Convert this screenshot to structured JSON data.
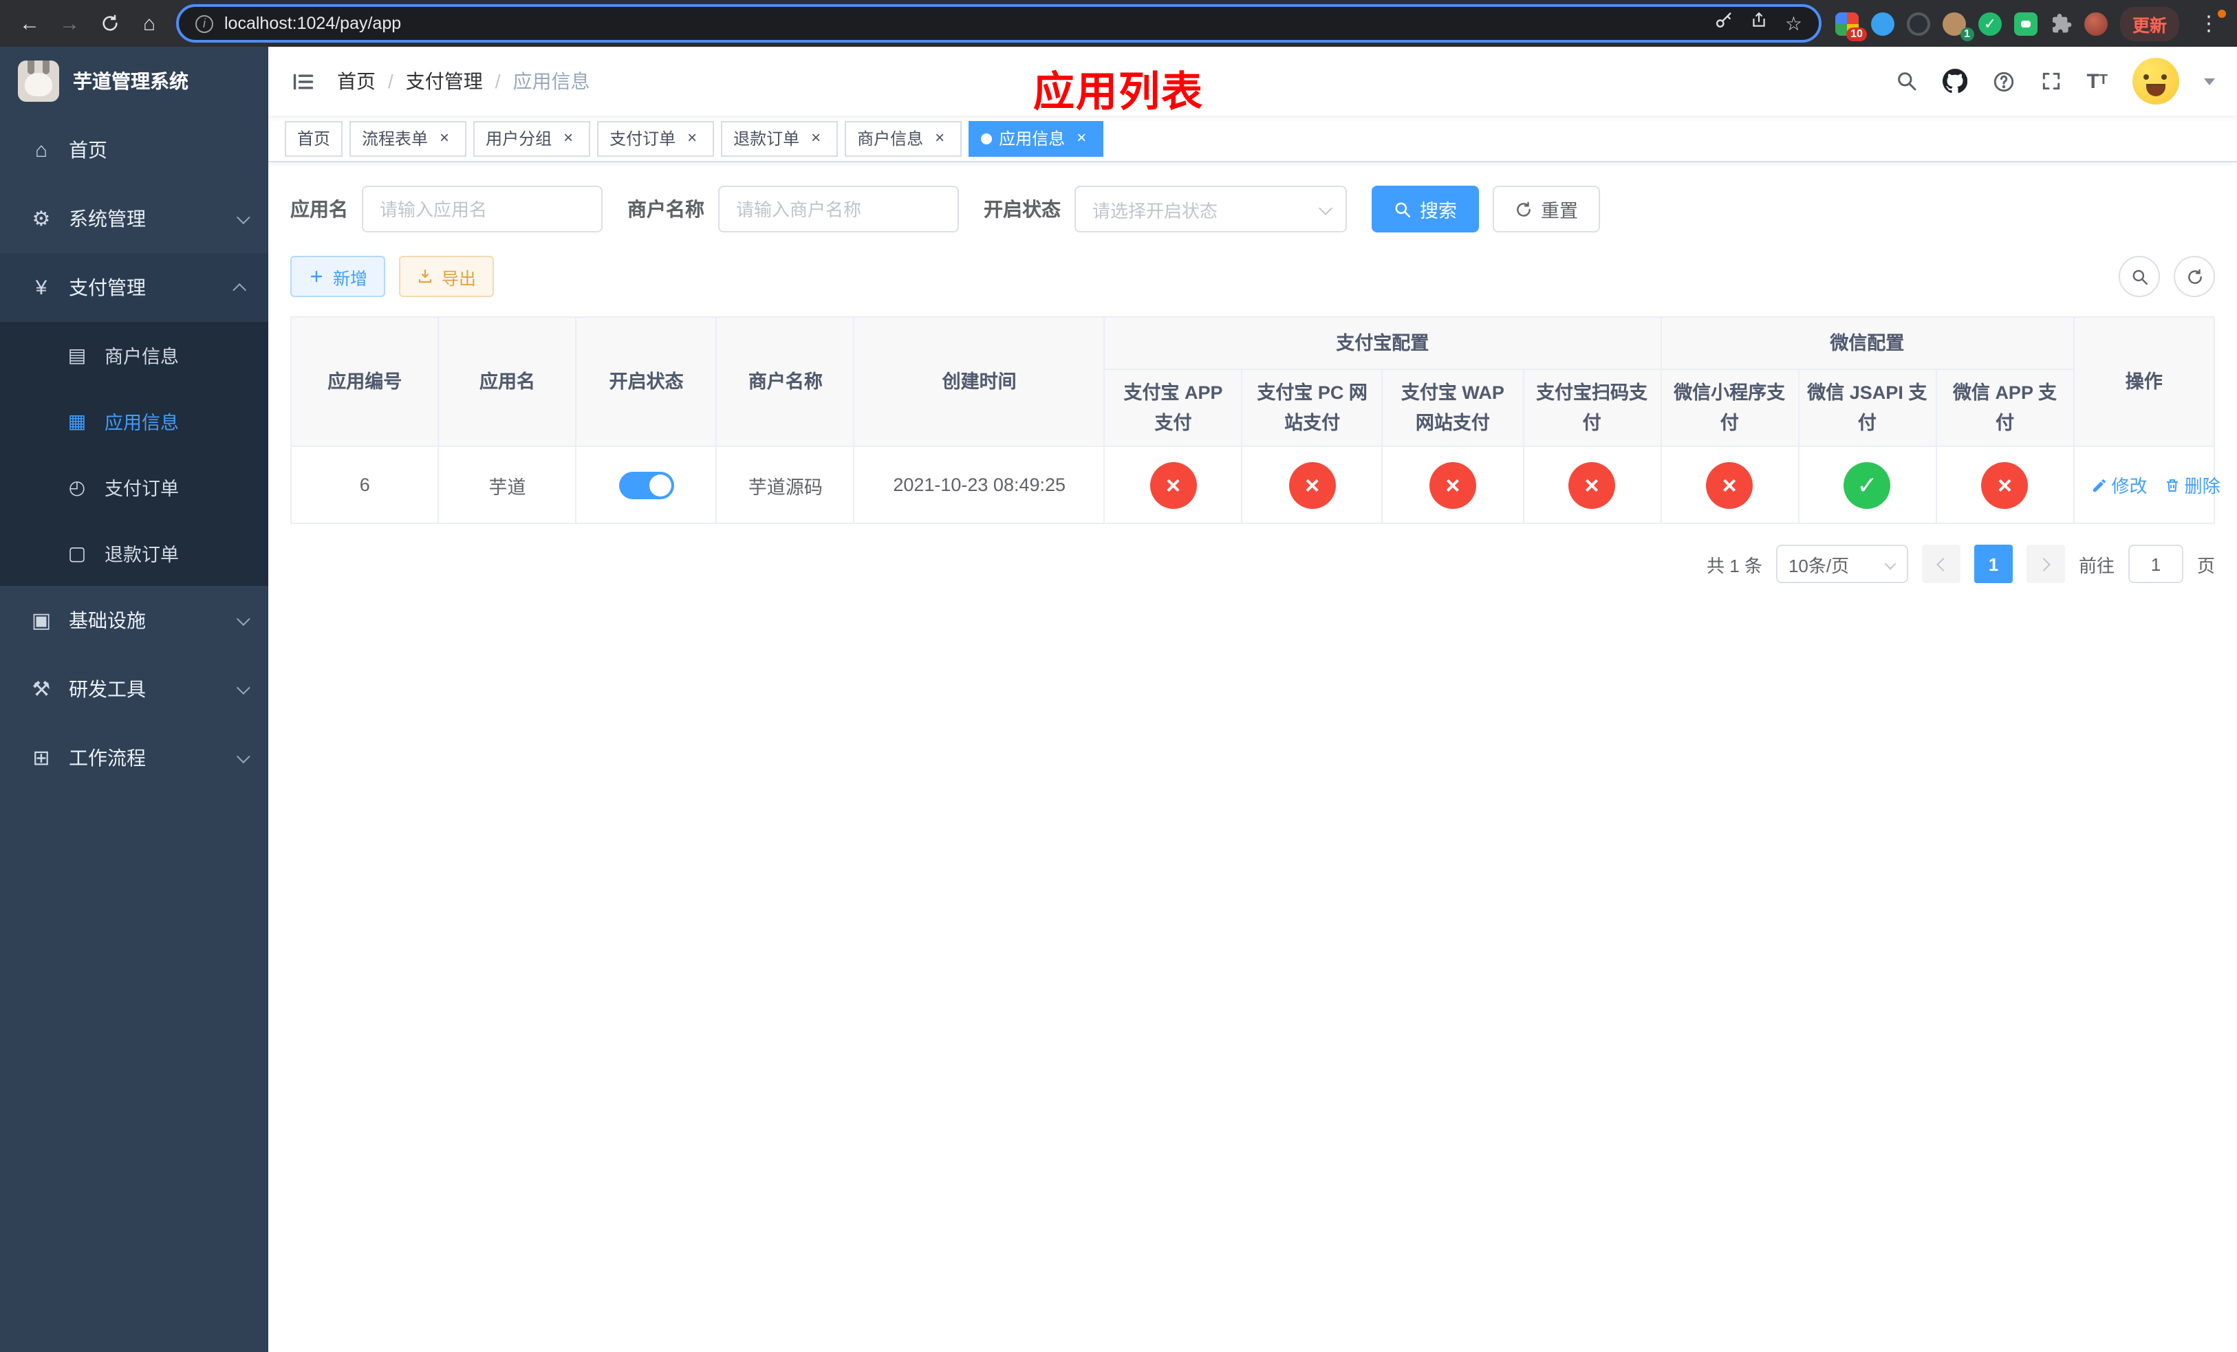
{
  "colors": {
    "accent": "#409eff",
    "danger": "#f5483b",
    "success": "#2bc458",
    "warning": "#e6a23c",
    "title_red": "#ff0000",
    "sidebar_bg": "#304156",
    "submenu_bg": "#1f2d3d"
  },
  "browser": {
    "url": "localhost:1024/pay/app",
    "update_label": "更新",
    "ext_badge_ten": "10",
    "ext_badge_one": "1"
  },
  "sidebar": {
    "logo_title": "芋道管理系统",
    "items": [
      {
        "label": "首页"
      },
      {
        "label": "系统管理"
      },
      {
        "label": "支付管理",
        "children": [
          {
            "label": "商户信息"
          },
          {
            "label": "应用信息"
          },
          {
            "label": "支付订单"
          },
          {
            "label": "退款订单"
          }
        ]
      },
      {
        "label": "基础设施"
      },
      {
        "label": "研发工具"
      },
      {
        "label": "工作流程"
      }
    ],
    "icons": {
      "home": "⌂",
      "system": "⚙",
      "pay": "¥",
      "merchant": "▤",
      "app": "▦",
      "order": "◴",
      "refund": "▢",
      "infra": "▣",
      "devtool": "⚒",
      "workflow": "⊞"
    }
  },
  "navbar": {
    "breadcrumb": [
      "首页",
      "支付管理",
      "应用信息"
    ],
    "page_title": "应用列表"
  },
  "tabs": [
    {
      "label": "首页"
    },
    {
      "label": "流程表单"
    },
    {
      "label": "用户分组"
    },
    {
      "label": "支付订单"
    },
    {
      "label": "退款订单"
    },
    {
      "label": "商户信息"
    },
    {
      "label": "应用信息"
    }
  ],
  "filters": {
    "app_name_label": "应用名",
    "app_name_placeholder": "请输入应用名",
    "merchant_label": "商户名称",
    "merchant_placeholder": "请输入商户名称",
    "status_label": "开启状态",
    "status_placeholder": "请选择开启状态",
    "search_label": "搜索",
    "reset_label": "重置"
  },
  "toolbar": {
    "add_label": "新增",
    "export_label": "导出"
  },
  "table": {
    "groups": {
      "alipay": "支付宝配置",
      "wechat": "微信配置"
    },
    "columns": [
      "应用编号",
      "应用名",
      "开启状态",
      "商户名称",
      "创建时间",
      "支付宝 APP 支付",
      "支付宝 PC 网站支付",
      "支付宝 WAP 网站支付",
      "支付宝扫码支付",
      "微信小程序支付",
      "微信 JSAPI 支付",
      "微信 APP 支付",
      "操作"
    ],
    "rows": [
      {
        "id": "6",
        "name": "芋道",
        "enabled": true,
        "merchant": "芋道源码",
        "created": "2021-10-23 08:49:25",
        "statuses": [
          false,
          false,
          false,
          false,
          false,
          true,
          false
        ],
        "actions": {
          "edit": "修改",
          "delete": "删除"
        }
      }
    ]
  },
  "pagination": {
    "total": "共 1 条",
    "page_size": "10条/页",
    "page": "1",
    "goto_label": "前往",
    "goto_value": "1",
    "unit": "页"
  }
}
